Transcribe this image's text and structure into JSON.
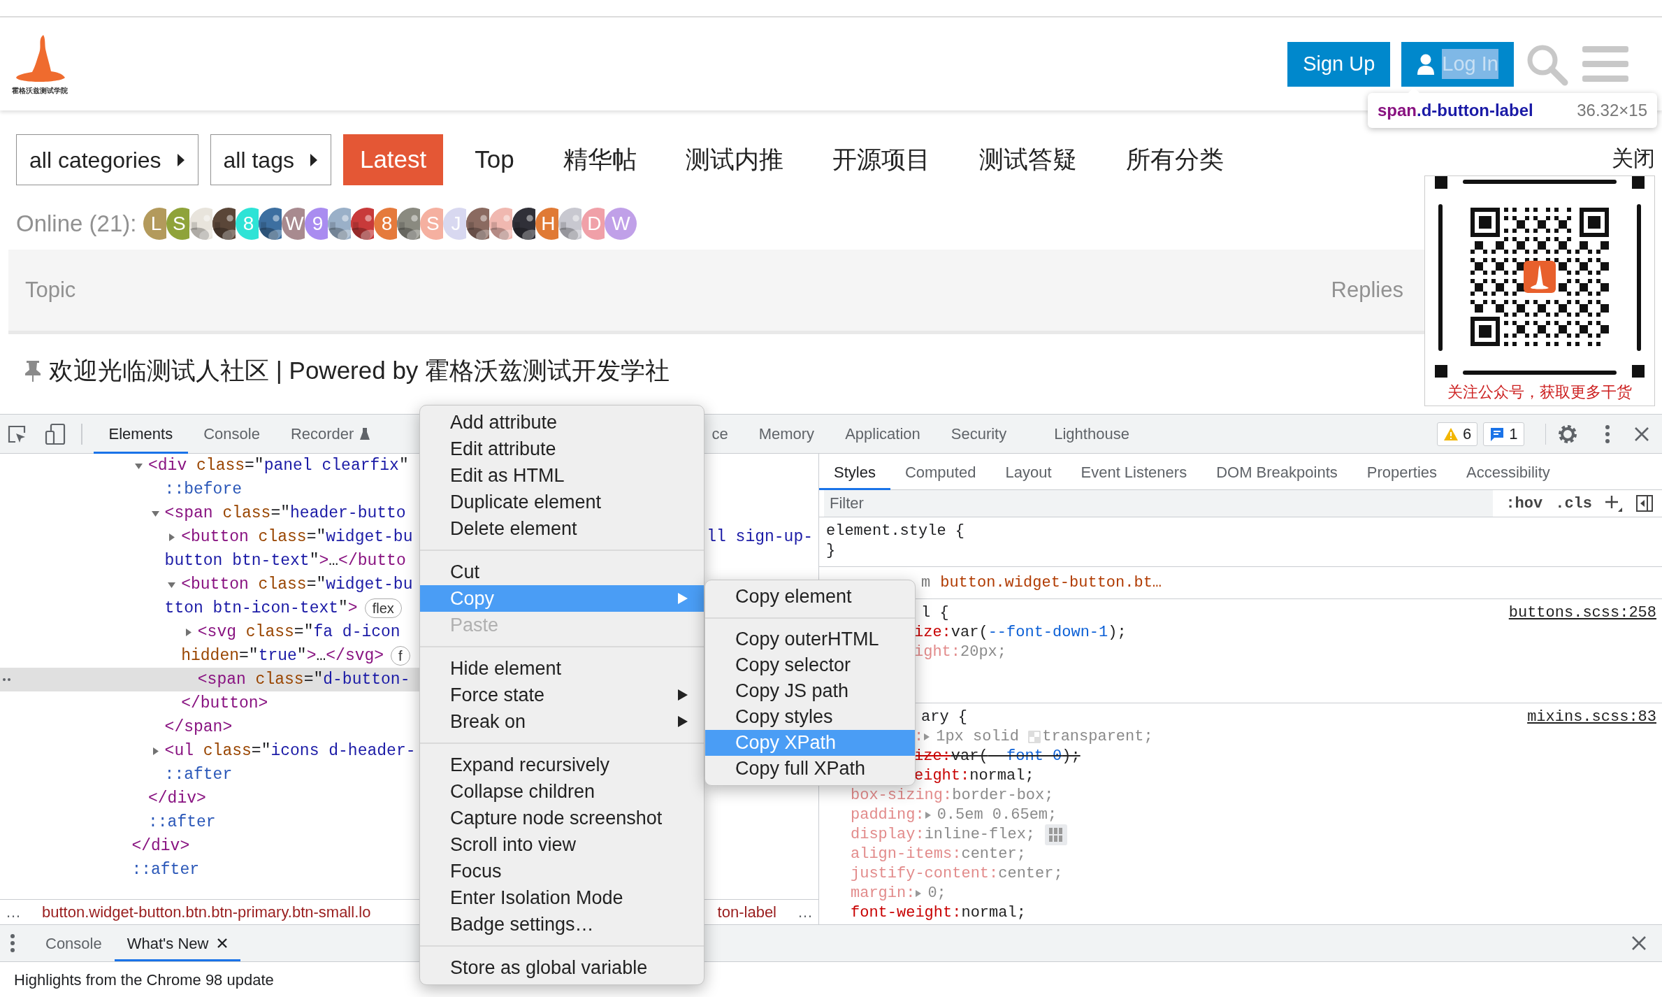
{
  "page": {
    "logo_text": "霍格沃兹测试学院",
    "header_buttons": [
      {
        "label": "Sign Up",
        "kind": "text",
        "highlighted": false
      },
      {
        "label": "Log In",
        "kind": "icon-text",
        "highlighted": true
      }
    ],
    "inspect_tooltip": {
      "tag": "span",
      "class": ".d-button-label",
      "size": "36.32×15"
    },
    "filters": [
      {
        "label": "all categories"
      },
      {
        "label": "all tags"
      }
    ],
    "nav": [
      {
        "label": "Latest",
        "selected": true
      },
      {
        "label": "Top",
        "selected": false
      },
      {
        "label": "精华帖",
        "selected": false
      },
      {
        "label": "测试内推",
        "selected": false
      },
      {
        "label": "开源项目",
        "selected": false
      },
      {
        "label": "测试答疑",
        "selected": false
      },
      {
        "label": "所有分类",
        "selected": false
      }
    ],
    "online": {
      "label": "Online (21):",
      "avatars": [
        {
          "kind": "letter",
          "letter": "L",
          "color": "#b39a5c"
        },
        {
          "kind": "letter",
          "letter": "S",
          "color": "#8fa33a"
        },
        {
          "kind": "picture",
          "color": "#e8e4dc"
        },
        {
          "kind": "picture",
          "color": "#5a4638"
        },
        {
          "kind": "letter",
          "letter": "8",
          "color": "#2ee3d6"
        },
        {
          "kind": "picture",
          "color": "#3d6fa0"
        },
        {
          "kind": "letter",
          "letter": "W",
          "color": "#a88a8f"
        },
        {
          "kind": "letter",
          "letter": "9",
          "color": "#a98cf0"
        },
        {
          "kind": "picture",
          "color": "#9ab0c8"
        },
        {
          "kind": "picture",
          "color": "#c83a3a"
        },
        {
          "kind": "letter",
          "letter": "8",
          "color": "#e57a3c"
        },
        {
          "kind": "picture",
          "color": "#8a8a80"
        },
        {
          "kind": "letter",
          "letter": "S",
          "color": "#f5b0a0"
        },
        {
          "kind": "letter",
          "letter": "J",
          "color": "#d8d8f0"
        },
        {
          "kind": "picture",
          "color": "#8a6a60"
        },
        {
          "kind": "picture",
          "color": "#f0b8b0"
        },
        {
          "kind": "picture",
          "color": "#303038"
        },
        {
          "kind": "letter",
          "letter": "H",
          "color": "#e07a35"
        },
        {
          "kind": "picture",
          "color": "#c8c8d0"
        },
        {
          "kind": "letter",
          "letter": "D",
          "color": "#f0a0a8"
        },
        {
          "kind": "letter",
          "letter": "W",
          "color": "#c0a0e8"
        }
      ]
    },
    "topic_list": {
      "columns": [
        "Topic",
        "Replies"
      ],
      "rows": [
        {
          "pinned": true,
          "title": "欢迎光临测试人社区 | Powered by 霍格沃兹测试开发学社"
        }
      ]
    },
    "qr_popup": {
      "close": "关闭",
      "caption": "关注公众号，获取更多干货"
    }
  },
  "devtools": {
    "tabs": [
      {
        "label": "Elements",
        "selected": true,
        "kind": "normal"
      },
      {
        "label": "Console",
        "selected": false,
        "kind": "normal"
      },
      {
        "label": "Recorder",
        "selected": false,
        "kind": "experimental"
      },
      {
        "label": "ce",
        "selected": false,
        "kind": "partial"
      },
      {
        "label": "Memory",
        "selected": false,
        "kind": "normal"
      },
      {
        "label": "Application",
        "selected": false,
        "kind": "normal"
      },
      {
        "label": "Security",
        "selected": false,
        "kind": "normal"
      },
      {
        "label": "Lighthouse",
        "selected": false,
        "kind": "wide"
      }
    ],
    "warnings": "6",
    "messages": "1",
    "dom_tree": [
      {
        "children": [
          {
            "lines": [
              {
                "parts": [
                  {
                    "kind": "tag",
                    "text": "<div"
                  },
                  {
                    "kind": "attr",
                    "text": " class"
                  },
                  {
                    "kind": "punct",
                    "text": "=\""
                  },
                  {
                    "kind": "val",
                    "text": "panel clearfix"
                  },
                  {
                    "kind": "punct",
                    "text": "\""
                  }
                ]
              }
            ],
            "expanded": true,
            "selected": false,
            "children": [
              {
                "lines": [
                  {
                    "parts": [
                      {
                        "kind": "pseudo",
                        "text": "::before"
                      }
                    ]
                  }
                ],
                "selected": false
              },
              {
                "lines": [
                  {
                    "parts": [
                      {
                        "kind": "tag",
                        "text": "<span"
                      },
                      {
                        "kind": "attr",
                        "text": " class"
                      },
                      {
                        "kind": "punct",
                        "text": "=\""
                      },
                      {
                        "kind": "val",
                        "text": "header-butto"
                      }
                    ]
                  }
                ],
                "expanded": true,
                "selected": false,
                "children": [
                  {
                    "lines": [
                      {
                        "parts": [
                          {
                            "kind": "tag",
                            "text": "<button"
                          },
                          {
                            "kind": "attr",
                            "text": " class"
                          },
                          {
                            "kind": "punct",
                            "text": "=\""
                          },
                          {
                            "kind": "val",
                            "text": "widget-bu"
                          }
                        ],
                        "fragment": "ll sign-up-"
                      },
                      {
                        "parts": [
                          {
                            "kind": "val",
                            "text": "button btn-text"
                          },
                          {
                            "kind": "punct",
                            "text": "\""
                          },
                          {
                            "kind": "tag",
                            "text": ">"
                          },
                          {
                            "kind": "punct",
                            "text": "…"
                          },
                          {
                            "kind": "tag",
                            "text": "</butto"
                          }
                        ]
                      }
                    ],
                    "expanded": false,
                    "selected": false
                  },
                  {
                    "lines": [
                      {
                        "parts": [
                          {
                            "kind": "tag",
                            "text": "<button"
                          },
                          {
                            "kind": "attr",
                            "text": " class"
                          },
                          {
                            "kind": "punct",
                            "text": "=\""
                          },
                          {
                            "kind": "val",
                            "text": "widget-bu"
                          }
                        ]
                      },
                      {
                        "parts": [
                          {
                            "kind": "val",
                            "text": "tton btn-icon-text"
                          },
                          {
                            "kind": "punct",
                            "text": "\""
                          },
                          {
                            "kind": "tag",
                            "text": ">"
                          }
                        ],
                        "badge": "flex"
                      }
                    ],
                    "expanded": true,
                    "selected": false,
                    "children": [
                      {
                        "lines": [
                          {
                            "parts": [
                              {
                                "kind": "tag",
                                "text": "<svg"
                              },
                              {
                                "kind": "attr",
                                "text": " class"
                              },
                              {
                                "kind": "punct",
                                "text": "=\""
                              },
                              {
                                "kind": "val",
                                "text": "fa d-icon"
                              }
                            ]
                          },
                          {
                            "parts": [
                              {
                                "kind": "attr",
                                "text": "hidden"
                              },
                              {
                                "kind": "punct",
                                "text": "=\""
                              },
                              {
                                "kind": "val",
                                "text": "true"
                              },
                              {
                                "kind": "punct",
                                "text": "\""
                              },
                              {
                                "kind": "tag",
                                "text": ">"
                              },
                              {
                                "kind": "punct",
                                "text": "…"
                              },
                              {
                                "kind": "tag",
                                "text": "</svg>"
                              }
                            ],
                            "badge": "f"
                          }
                        ],
                        "expanded": false,
                        "selected": false
                      },
                      {
                        "lines": [
                          {
                            "parts": [
                              {
                                "kind": "tag",
                                "text": "<span"
                              },
                              {
                                "kind": "attr",
                                "text": " class"
                              },
                              {
                                "kind": "punct",
                                "text": "=\""
                              },
                              {
                                "kind": "val",
                                "text": "d-button-"
                              }
                            ]
                          }
                        ],
                        "selected": true
                      }
                    ],
                    "close": [
                      {
                        "kind": "tag",
                        "text": "</button>"
                      }
                    ]
                  }
                ],
                "close": [
                  {
                    "kind": "tag",
                    "text": "</span>"
                  }
                ]
              },
              {
                "lines": [
                  {
                    "parts": [
                      {
                        "kind": "tag",
                        "text": "<ul"
                      },
                      {
                        "kind": "attr",
                        "text": " class"
                      },
                      {
                        "kind": "punct",
                        "text": "=\""
                      },
                      {
                        "kind": "val",
                        "text": "icons d-header-"
                      }
                    ]
                  }
                ],
                "expanded": false,
                "selected": false
              },
              {
                "lines": [
                  {
                    "parts": [
                      {
                        "kind": "pseudo",
                        "text": "::after"
                      }
                    ]
                  }
                ],
                "selected": false
              }
            ],
            "close": [
              {
                "kind": "tag",
                "text": "</div>"
              }
            ]
          },
          {
            "lines": [
              {
                "parts": [
                  {
                    "kind": "pseudo",
                    "text": "::after"
                  }
                ]
              }
            ],
            "selected": false
          }
        ],
        "close": [
          {
            "kind": "tag",
            "text": "</div>"
          }
        ]
      },
      {
        "lines": [
          {
            "parts": [
              {
                "kind": "pseudo",
                "text": "::after"
              }
            ]
          }
        ],
        "selected": false
      }
    ],
    "breadcrumb": {
      "lead": "…",
      "path": "button.widget-button.btn.btn-primary.btn-small.lo",
      "tail": "ton-label",
      "trail": "…"
    },
    "sidebar_tabs": [
      {
        "label": "Styles",
        "selected": true
      },
      {
        "label": "Computed",
        "selected": false
      },
      {
        "label": "Layout",
        "selected": false
      },
      {
        "label": "Event Listeners",
        "selected": false
      },
      {
        "label": "DOM Breakpoints",
        "selected": false
      },
      {
        "label": "Properties",
        "selected": false
      },
      {
        "label": "Accessibility",
        "selected": false
      }
    ],
    "filter": {
      "placeholder": "Filter",
      "hov": ":hov",
      "cls": ".cls"
    },
    "styles": [
      {
        "kind": "rule",
        "selector": "element.style {",
        "close": "}"
      },
      {
        "kind": "inherited",
        "prefix": "m",
        "selector": "button.widget-button.bt…"
      },
      {
        "kind": "rule",
        "partial": true,
        "selector": "l {",
        "source": "buttons.scss:258",
        "decls": [
          {
            "partial": true,
            "dimmed": false,
            "overridden": false,
            "prop": "ize:",
            "value": [
              {
                "kind": "plain",
                "text": "var("
              },
              {
                "kind": "var",
                "text": "--font-down-1"
              },
              {
                "kind": "plain",
                "text": ");"
              }
            ]
          },
          {
            "partial": true,
            "dimmed": true,
            "overridden": false,
            "prop": "ight:",
            "value": [
              {
                "kind": "plain",
                "text": "20px;"
              }
            ]
          }
        ]
      },
      {
        "kind": "rule",
        "partial": true,
        "selector": "ary {",
        "source": "mixins.scss:83",
        "decls": [
          {
            "partial": true,
            "dimmed": true,
            "overridden": false,
            "expander": true,
            "prop": ":",
            "value": [
              {
                "kind": "plain",
                "text": "1px solid"
              },
              {
                "kind": "swatch",
                "text": "transparent;"
              }
            ]
          },
          {
            "partial": true,
            "dimmed": false,
            "overridden": true,
            "prop": "ize:",
            "value": [
              {
                "kind": "plain",
                "text": "var("
              },
              {
                "kind": "var",
                "text": "--font-0"
              },
              {
                "kind": "plain",
                "text": ");"
              }
            ]
          },
          {
            "partial": true,
            "dimmed": false,
            "overridden": false,
            "prop": "eight:",
            "value": [
              {
                "kind": "plain",
                "text": "normal;"
              }
            ]
          },
          {
            "dimmed": true,
            "overridden": false,
            "prop": "box-sizing:",
            "value": [
              {
                "kind": "plain",
                "text": "border-box;"
              }
            ]
          },
          {
            "dimmed": true,
            "overridden": false,
            "expander": true,
            "prop": "padding:",
            "value": [
              {
                "kind": "plain",
                "text": "0.5em 0.65em;"
              }
            ]
          },
          {
            "dimmed": true,
            "overridden": false,
            "flex_editor": true,
            "prop": "display:",
            "value": [
              {
                "kind": "plain",
                "text": "inline-flex;"
              }
            ]
          },
          {
            "dimmed": true,
            "overridden": false,
            "prop": "align-items:",
            "value": [
              {
                "kind": "plain",
                "text": "center;"
              }
            ]
          },
          {
            "dimmed": true,
            "overridden": false,
            "prop": "justify-content:",
            "value": [
              {
                "kind": "plain",
                "text": "center;"
              }
            ]
          },
          {
            "dimmed": true,
            "overridden": false,
            "expander": true,
            "prop": "margin:",
            "value": [
              {
                "kind": "plain",
                "text": "0;"
              }
            ]
          },
          {
            "dimmed": false,
            "overridden": false,
            "prop": "font-weight:",
            "value": [
              {
                "kind": "plain",
                "text": "normal;"
              }
            ]
          }
        ]
      }
    ],
    "drawer": {
      "tabs": [
        {
          "label": "Console",
          "selected": false,
          "closable": false
        },
        {
          "label": "What's New",
          "selected": true,
          "closable": true
        }
      ],
      "content": "Highlights from the Chrome 98 update"
    }
  },
  "context_menu": {
    "groups": [
      [
        {
          "label": "Add attribute",
          "selected": false,
          "disabled": false,
          "submenu": false
        },
        {
          "label": "Edit attribute",
          "selected": false,
          "disabled": false,
          "submenu": false
        },
        {
          "label": "Edit as HTML",
          "selected": false,
          "disabled": false,
          "submenu": false
        },
        {
          "label": "Duplicate element",
          "selected": false,
          "disabled": false,
          "submenu": false
        },
        {
          "label": "Delete element",
          "selected": false,
          "disabled": false,
          "submenu": false
        }
      ],
      [
        {
          "label": "Cut",
          "selected": false,
          "disabled": false,
          "submenu": false
        },
        {
          "label": "Copy",
          "selected": true,
          "disabled": false,
          "submenu": true
        },
        {
          "label": "Paste",
          "selected": false,
          "disabled": true,
          "submenu": false
        }
      ],
      [
        {
          "label": "Hide element",
          "selected": false,
          "disabled": false,
          "submenu": false
        },
        {
          "label": "Force state",
          "selected": false,
          "disabled": false,
          "submenu": true
        },
        {
          "label": "Break on",
          "selected": false,
          "disabled": false,
          "submenu": true
        }
      ],
      [
        {
          "label": "Expand recursively",
          "selected": false,
          "disabled": false,
          "submenu": false
        },
        {
          "label": "Collapse children",
          "selected": false,
          "disabled": false,
          "submenu": false
        },
        {
          "label": "Capture node screenshot",
          "selected": false,
          "disabled": false,
          "submenu": false
        },
        {
          "label": "Scroll into view",
          "selected": false,
          "disabled": false,
          "submenu": false
        },
        {
          "label": "Focus",
          "selected": false,
          "disabled": false,
          "submenu": false
        },
        {
          "label": "Enter Isolation Mode",
          "selected": false,
          "disabled": false,
          "submenu": false
        },
        {
          "label": "Badge settings…",
          "selected": false,
          "disabled": false,
          "submenu": false
        }
      ],
      [
        {
          "label": "Store as global variable",
          "selected": false,
          "disabled": false,
          "submenu": false
        }
      ]
    ]
  },
  "submenu": {
    "groups": [
      [
        {
          "label": "Copy element",
          "selected": false,
          "disabled": false,
          "submenu": false
        }
      ],
      [
        {
          "label": "Copy outerHTML",
          "selected": false,
          "disabled": false,
          "submenu": false
        },
        {
          "label": "Copy selector",
          "selected": false,
          "disabled": false,
          "submenu": false
        },
        {
          "label": "Copy JS path",
          "selected": false,
          "disabled": false,
          "submenu": false
        },
        {
          "label": "Copy styles",
          "selected": false,
          "disabled": false,
          "submenu": false
        },
        {
          "label": "Copy XPath",
          "selected": true,
          "disabled": false,
          "submenu": false
        },
        {
          "label": "Copy full XPath",
          "selected": false,
          "disabled": false,
          "submenu": false
        }
      ]
    ]
  }
}
